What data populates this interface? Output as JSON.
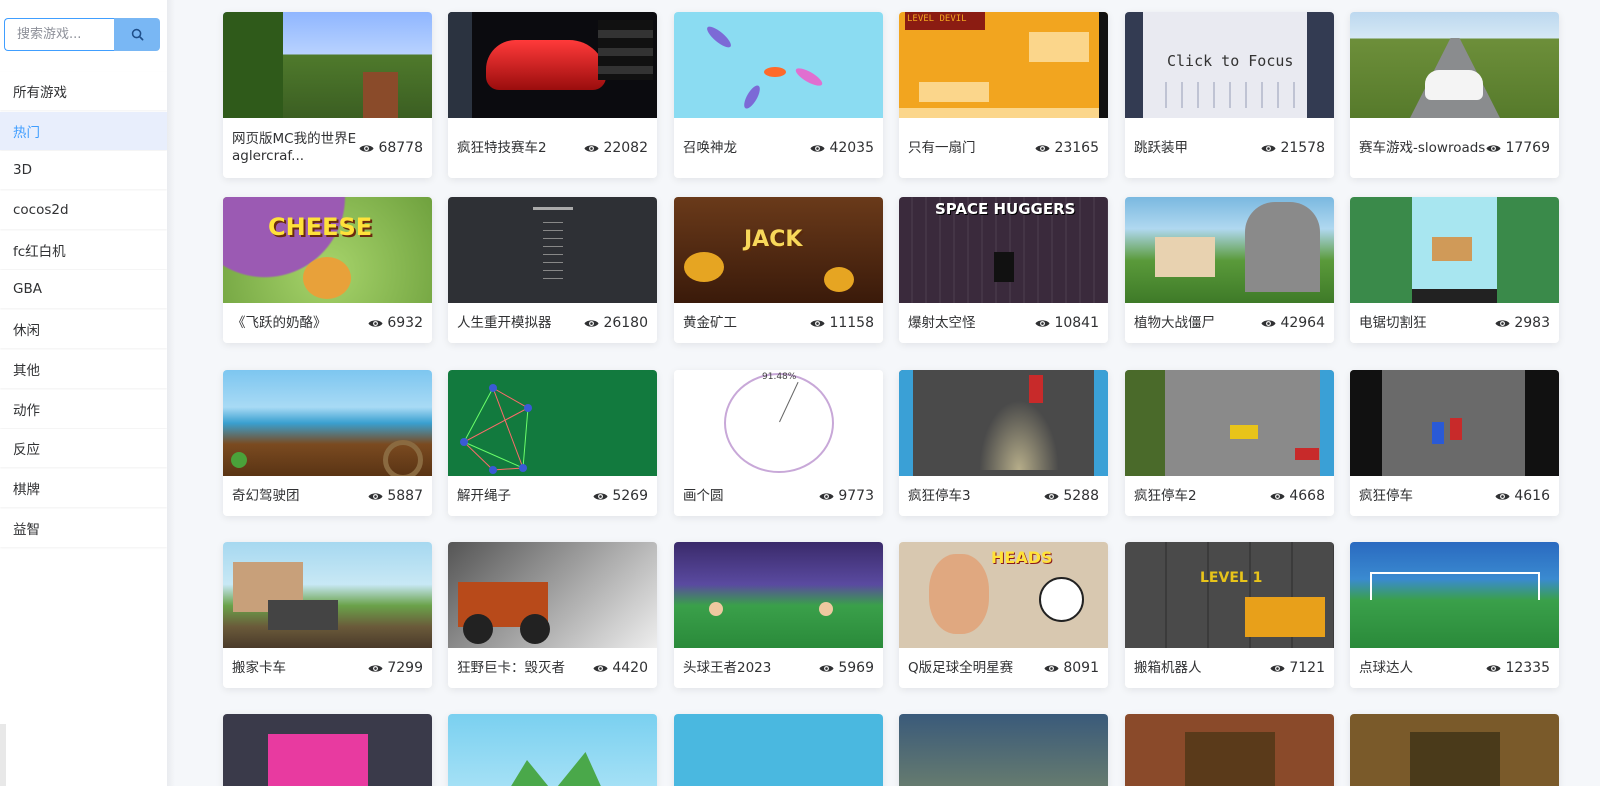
{
  "search": {
    "placeholder": "搜索游戏..."
  },
  "categories": [
    {
      "label": "所有游戏",
      "active": false
    },
    {
      "label": "热门",
      "active": true
    },
    {
      "label": "3D",
      "active": false
    },
    {
      "label": "cocos2d",
      "active": false
    },
    {
      "label": "fc红白机",
      "active": false
    },
    {
      "label": "GBA",
      "active": false
    },
    {
      "label": "休闲",
      "active": false
    },
    {
      "label": "其他",
      "active": false
    },
    {
      "label": "动作",
      "active": false
    },
    {
      "label": "反应",
      "active": false
    },
    {
      "label": "棋牌",
      "active": false
    },
    {
      "label": "益智",
      "active": false
    }
  ],
  "games": [
    {
      "title": "网页版MC我的世界Eaglercraf...",
      "views": "68778",
      "thumb": "mc"
    },
    {
      "title": "疯狂特技赛车2",
      "views": "22082",
      "thumb": "car"
    },
    {
      "title": "召唤神龙",
      "views": "42035",
      "thumb": "dragon"
    },
    {
      "title": "只有一扇门",
      "views": "23165",
      "thumb": "door",
      "thumb_text": "LEVEL DEVIL"
    },
    {
      "title": "跳跃装甲",
      "views": "21578",
      "thumb": "armor",
      "thumb_text": "Click to Focus"
    },
    {
      "title": "赛车游戏-slowroads",
      "views": "17769",
      "thumb": "road"
    },
    {
      "title": "《飞跃的奶酪》",
      "views": "6932",
      "thumb": "cheese",
      "thumb_text": "CHEESE"
    },
    {
      "title": "人生重开模拟器",
      "views": "26180",
      "thumb": "life"
    },
    {
      "title": "黄金矿工",
      "views": "11158",
      "thumb": "gold",
      "thumb_text": "JACK"
    },
    {
      "title": "爆射太空怪",
      "views": "10841",
      "thumb": "space",
      "thumb_text": "SPACE HUGGERS"
    },
    {
      "title": "植物大战僵尸",
      "views": "42964",
      "thumb": "pvz"
    },
    {
      "title": "电锯切割狂",
      "views": "2983",
      "thumb": "saw"
    },
    {
      "title": "奇幻驾驶团",
      "views": "5887",
      "thumb": "drive"
    },
    {
      "title": "解开绳子",
      "views": "5269",
      "thumb": "rope"
    },
    {
      "title": "画个圆",
      "views": "9773",
      "thumb": "circle",
      "thumb_text": "91.48%"
    },
    {
      "title": "疯狂停车3",
      "views": "5288",
      "thumb": "park3"
    },
    {
      "title": "疯狂停车2",
      "views": "4668",
      "thumb": "park2"
    },
    {
      "title": "疯狂停车",
      "views": "4616",
      "thumb": "park1"
    },
    {
      "title": "搬家卡车",
      "views": "7299",
      "thumb": "truck"
    },
    {
      "title": "狂野巨卡：毁灭者",
      "views": "4420",
      "thumb": "monster"
    },
    {
      "title": "头球王者2023",
      "views": "5969",
      "thumb": "head"
    },
    {
      "title": "Q版足球全明星赛",
      "views": "8091",
      "thumb": "qball",
      "thumb_text": "HEADS"
    },
    {
      "title": "搬箱机器人",
      "views": "7121",
      "thumb": "box",
      "thumb_text": "LEVEL 1"
    },
    {
      "title": "点球达人",
      "views": "12335",
      "thumb": "penalty"
    },
    {
      "title": "",
      "views": "",
      "thumb": "r5a"
    },
    {
      "title": "",
      "views": "",
      "thumb": "r5b"
    },
    {
      "title": "",
      "views": "",
      "thumb": "r5c"
    },
    {
      "title": "",
      "views": "",
      "thumb": "r5d"
    },
    {
      "title": "",
      "views": "",
      "thumb": "r5e"
    },
    {
      "title": "",
      "views": "",
      "thumb": "r5f"
    }
  ],
  "colors": {
    "accent": "#409eff",
    "search_button": "#79b7f4",
    "active_bg": "#e8eefc"
  }
}
